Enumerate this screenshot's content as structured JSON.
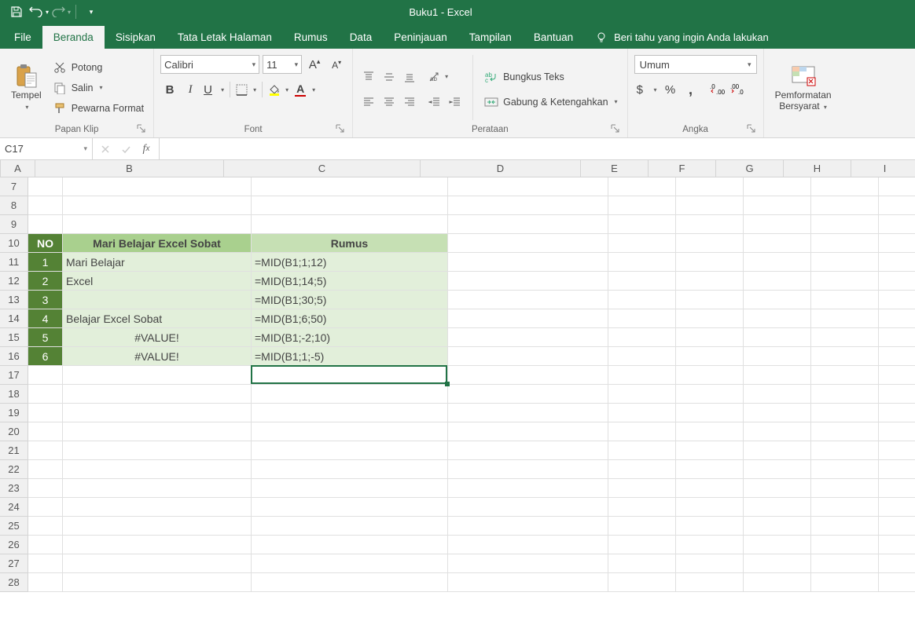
{
  "title": "Buku1  -  Excel",
  "qat": {
    "save": "save",
    "undo": "undo",
    "redo": "redo"
  },
  "tabs": {
    "file": "File",
    "home": "Beranda",
    "insert": "Sisipkan",
    "layout": "Tata Letak Halaman",
    "formulas": "Rumus",
    "data": "Data",
    "review": "Peninjauan",
    "view": "Tampilan",
    "help": "Bantuan",
    "tellme": "Beri tahu yang ingin Anda lakukan"
  },
  "ribbon": {
    "clipboard": {
      "paste": "Tempel",
      "cut": "Potong",
      "copy": "Salin",
      "painter": "Pewarna Format",
      "label": "Papan Klip"
    },
    "font": {
      "name": "Calibri",
      "size": "11",
      "label": "Font"
    },
    "align": {
      "wrap": "Bungkus Teks",
      "merge": "Gabung & Ketengahkan",
      "label": "Perataan"
    },
    "number": {
      "format": "Umum",
      "label": "Angka"
    },
    "cond": {
      "label1": "Pemformatan",
      "label2": "Bersyarat"
    }
  },
  "namebox": "C17",
  "columns": [
    "A",
    "B",
    "C",
    "D",
    "E",
    "F",
    "G",
    "H",
    "I"
  ],
  "colWidths": {
    "A": 44,
    "B": 240,
    "C": 250,
    "D": 204,
    "E": 86,
    "F": 86,
    "G": 86,
    "H": 86,
    "I": 86
  },
  "rowStart": 7,
  "rowEnd": 28,
  "headerRow": 10,
  "headers": {
    "A": "NO",
    "B": "Mari Belajar Excel Sobat",
    "C": "Rumus"
  },
  "rows": [
    {
      "n": "1",
      "b": "Mari Belajar",
      "c": "=MID(B1;1;12)",
      "bcenter": false
    },
    {
      "n": "2",
      "b": "Excel",
      "c": "=MID(B1;14;5)",
      "bcenter": false
    },
    {
      "n": "3",
      "b": "",
      "c": "=MID(B1;30;5)",
      "bcenter": false
    },
    {
      "n": "4",
      "b": "Belajar Excel Sobat",
      "c": "=MID(B1;6;50)",
      "bcenter": false
    },
    {
      "n": "5",
      "b": "#VALUE!",
      "c": "=MID(B1;-2;10)",
      "bcenter": true
    },
    {
      "n": "6",
      "b": "#VALUE!",
      "c": "=MID(B1;1;-5)",
      "bcenter": true
    }
  ],
  "selection": {
    "cell": "C17"
  }
}
